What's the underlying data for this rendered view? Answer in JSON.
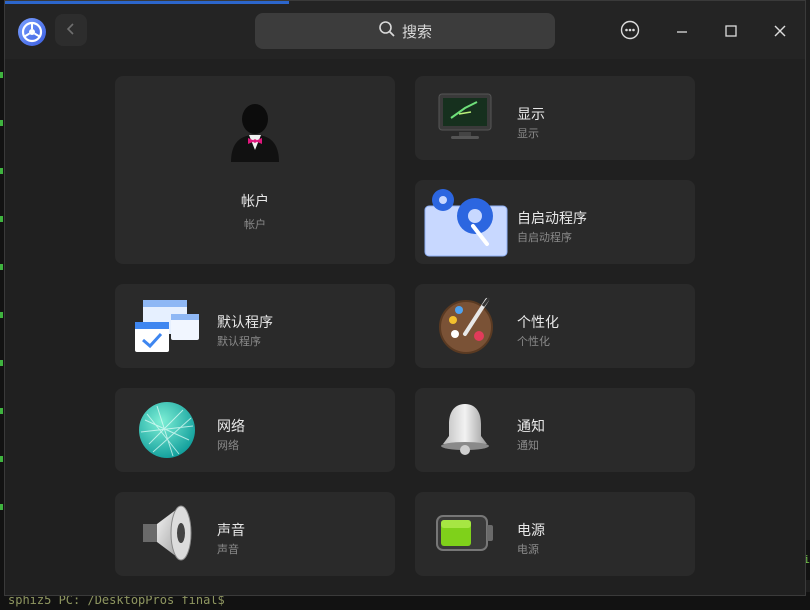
{
  "search": {
    "label": "搜索"
  },
  "terminal": {
    "prompt_text": "sphiz5 PC: /DesktopPros final$",
    "right_char": "i"
  },
  "cards": {
    "account": {
      "title": "帐户",
      "subtitle": "帐户",
      "icon": "account-user-icon"
    },
    "display": {
      "title": "显示",
      "subtitle": "显示",
      "icon": "display-monitor-icon"
    },
    "autostart": {
      "title": "自启动程序",
      "subtitle": "自启动程序",
      "icon": "autostart-gears-icon"
    },
    "default_apps": {
      "title": "默认程序",
      "subtitle": "默认程序",
      "icon": "default-apps-windows-icon"
    },
    "personalization": {
      "title": "个性化",
      "subtitle": "个性化",
      "icon": "palette-icon"
    },
    "network": {
      "title": "网络",
      "subtitle": "网络",
      "icon": "network-globe-icon"
    },
    "notification": {
      "title": "通知",
      "subtitle": "通知",
      "icon": "bell-icon"
    },
    "sound": {
      "title": "声音",
      "subtitle": "声音",
      "icon": "speaker-icon"
    },
    "power": {
      "title": "电源",
      "subtitle": "电源",
      "icon": "battery-icon"
    }
  },
  "colors": {
    "accent": "#2c66cc",
    "window_bg": "#202020",
    "card_bg": "#2a2a2a"
  }
}
